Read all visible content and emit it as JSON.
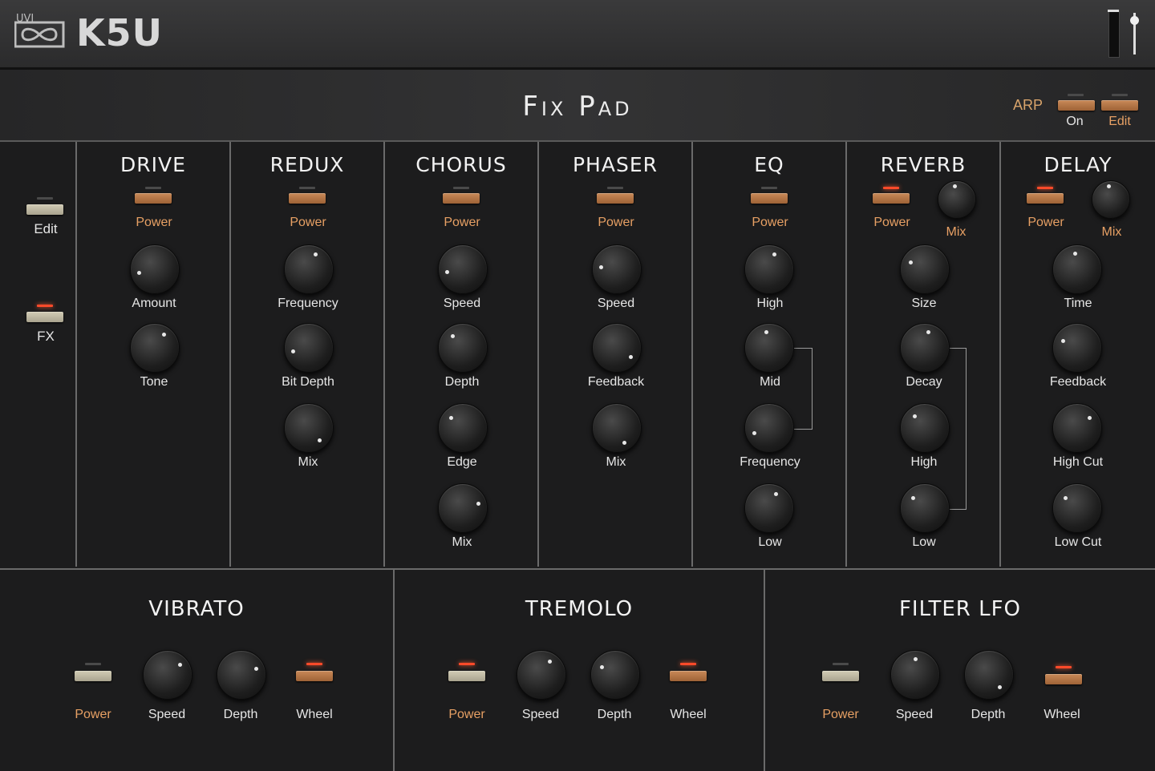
{
  "header": {
    "brand": "UVI",
    "product": "K5U"
  },
  "preset": {
    "name": "Fix Pad"
  },
  "arp": {
    "label": "ARP",
    "on_label": "On",
    "edit_label": "Edit"
  },
  "sidebar": {
    "edit_label": "Edit",
    "fx_label": "FX"
  },
  "panels": {
    "drive": {
      "title": "DRIVE",
      "power": "Power",
      "k1": "Amount",
      "k2": "Tone"
    },
    "redux": {
      "title": "REDUX",
      "power": "Power",
      "k1": "Frequency",
      "k2": "Bit Depth",
      "k3": "Mix"
    },
    "chorus": {
      "title": "CHORUS",
      "power": "Power",
      "k1": "Speed",
      "k2": "Depth",
      "k3": "Edge",
      "k4": "Mix"
    },
    "phaser": {
      "title": "PHASER",
      "power": "Power",
      "k1": "Speed",
      "k2": "Feedback",
      "k3": "Mix"
    },
    "eq": {
      "title": "EQ",
      "power": "Power",
      "k1": "High",
      "k2": "Mid",
      "k3": "Frequency",
      "k4": "Low"
    },
    "reverb": {
      "title": "REVERB",
      "power": "Power",
      "mix": "Mix",
      "k1": "Size",
      "k2": "Decay",
      "k3": "High",
      "k4": "Low"
    },
    "delay": {
      "title": "DELAY",
      "power": "Power",
      "mix": "Mix",
      "k1": "Time",
      "k2": "Feedback",
      "k3": "High Cut",
      "k4": "Low Cut"
    }
  },
  "bottom": {
    "vibrato": {
      "title": "VIBRATO",
      "power": "Power",
      "speed": "Speed",
      "depth": "Depth",
      "wheel": "Wheel"
    },
    "tremolo": {
      "title": "TREMOLO",
      "power": "Power",
      "speed": "Speed",
      "depth": "Depth",
      "wheel": "Wheel"
    },
    "filterlfo": {
      "title": "FILTER LFO",
      "power": "Power",
      "speed": "Speed",
      "depth": "Depth",
      "wheel": "Wheel"
    }
  },
  "colors": {
    "accent_copper": "#c98a58",
    "led_on": "#ff4a2a",
    "label_orange": "#e7a064"
  }
}
